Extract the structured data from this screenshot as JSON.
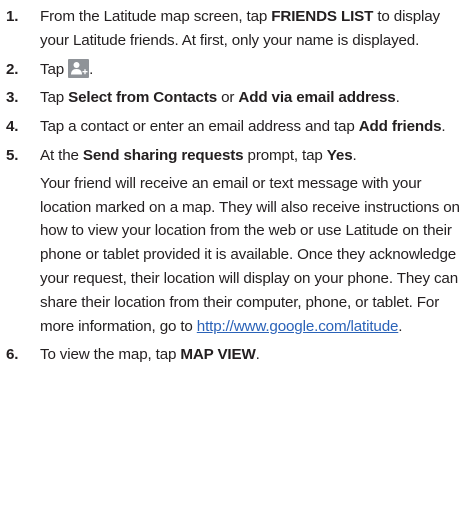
{
  "steps": [
    {
      "number": "1.",
      "t1": "From the Latitude map screen, tap ",
      "b1": "FRIENDS LIST",
      "t2": " to display your Latitude friends. At first, only your name is displayed."
    },
    {
      "number": "2.",
      "t1": "Tap ",
      "icon": "add-friend-icon",
      "t2": "."
    },
    {
      "number": "3.",
      "t1": "Tap ",
      "b1": "Select from Contacts",
      "t2": " or ",
      "b2": "Add via email address",
      "t3": "."
    },
    {
      "number": "4.",
      "t1": "Tap a contact or enter an email address and tap ",
      "b1": "Add friends",
      "t2": "."
    },
    {
      "number": "5.",
      "t1": "At the ",
      "b1": "Send sharing requests",
      "t2": " prompt, tap ",
      "b2": "Yes",
      "t3": ".",
      "note": "Your friend will receive an email or text message with your location marked on a map. They will also receive instructions on how to view your location from the web or use Latitude on their phone or tablet provided it is available. Once they acknowledge your request, their location will display on your phone. They can share their location from their computer, phone, or tablet. For more information, go to ",
      "link": "http://www.google.com/latitude",
      "note_end": "."
    },
    {
      "number": "6.",
      "t1": "To view the map, tap ",
      "b1": "MAP VIEW",
      "t2": "."
    }
  ],
  "colors": {
    "text": "#231f20",
    "link": "#2a62b8",
    "icon_bg": "#8f9398"
  }
}
